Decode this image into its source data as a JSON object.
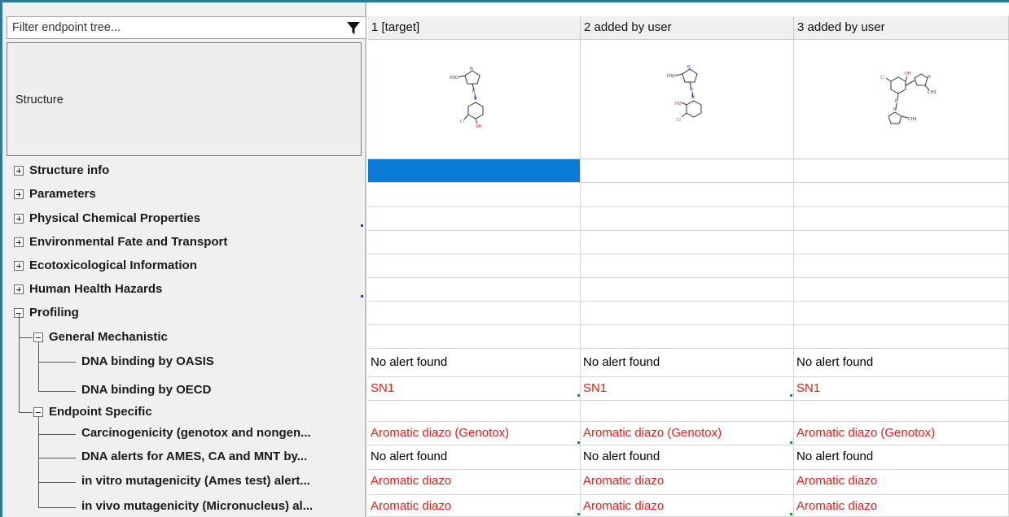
{
  "filter": {
    "placeholder": "Filter endpoint tree..."
  },
  "structure_label": "Structure",
  "tree": {
    "items": [
      {
        "label": "Structure info",
        "expander": "plus"
      },
      {
        "label": "Parameters",
        "expander": "plus"
      },
      {
        "label": "Physical Chemical Properties",
        "expander": "plus"
      },
      {
        "label": "Environmental Fate and Transport",
        "expander": "plus"
      },
      {
        "label": "Ecotoxicological Information",
        "expander": "plus"
      },
      {
        "label": "Human Health Hazards",
        "expander": "plus"
      },
      {
        "label": "Profiling",
        "expander": "minus"
      },
      {
        "label": "General Mechanistic",
        "expander": "minus"
      },
      {
        "label": "DNA binding by OASIS"
      },
      {
        "label": "DNA binding by OECD"
      },
      {
        "label": "Endpoint Specific",
        "expander": "minus"
      },
      {
        "label": "Carcinogenicity (genotox and nongen..."
      },
      {
        "label": "DNA alerts for AMES, CA and MNT by..."
      },
      {
        "label": "in vitro mutagenicity (Ames test) alert..."
      },
      {
        "label": "in vivo mutagenicity (Micronucleus) al..."
      }
    ]
  },
  "columns": [
    {
      "header": "1 [target]"
    },
    {
      "header": "2 added by user"
    },
    {
      "header": "3 added by user"
    }
  ],
  "structures": [
    {
      "labels": [
        "H3C",
        "N",
        "N",
        "N",
        "Cl",
        "OH"
      ]
    },
    {
      "labels": [
        "H3C",
        "N",
        "N",
        "N",
        "HO",
        "Cl"
      ]
    },
    {
      "labels": [
        "Cl",
        "OH",
        "N",
        "CH3",
        "N",
        "N",
        "CH3"
      ]
    }
  ],
  "values": {
    "dna_oasis": [
      "No alert found",
      "No alert found",
      "No alert found"
    ],
    "dna_oecd": [
      "SN1",
      "SN1",
      "SN1"
    ],
    "carcinogenicity": [
      "Aromatic diazo (Genotox)",
      "Aromatic diazo (Genotox)",
      "Aromatic diazo (Genotox)"
    ],
    "dna_alerts": [
      "No alert found",
      "No alert found",
      "No alert found"
    ],
    "in_vitro": [
      "Aromatic diazo",
      "Aromatic diazo",
      "Aromatic diazo"
    ],
    "in_vivo": [
      "Aromatic diazo",
      "Aromatic diazo",
      "Aromatic diazo"
    ]
  },
  "colors": {
    "alert_red": "#e0201d",
    "selection_blue": "#0a7bd4",
    "frame_teal": "#2b7a9a"
  }
}
